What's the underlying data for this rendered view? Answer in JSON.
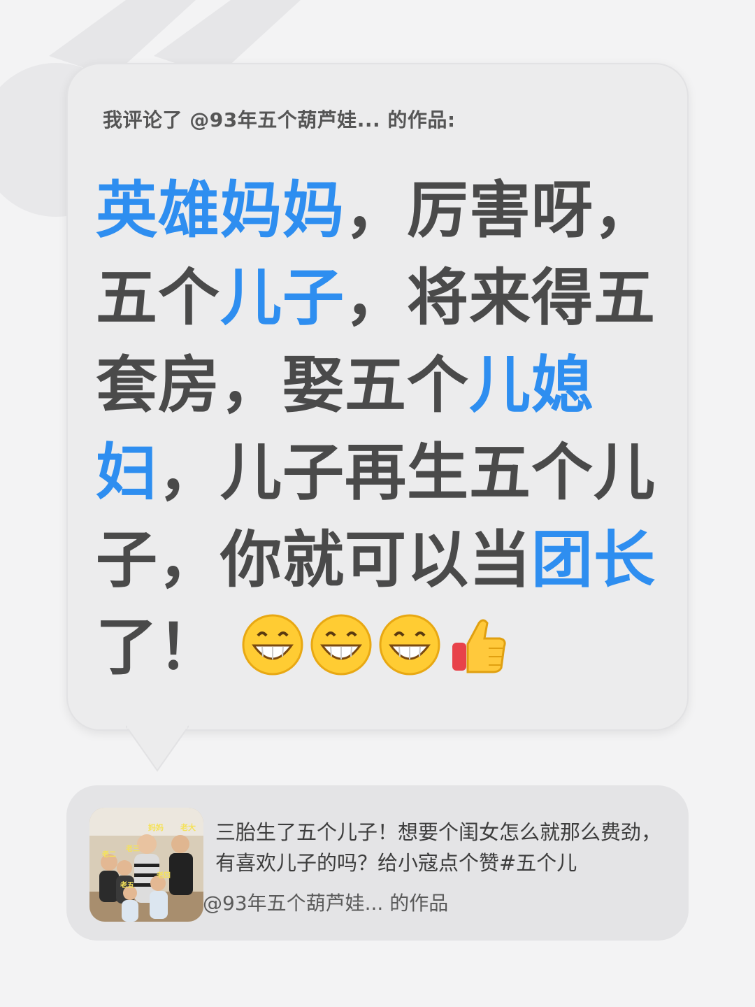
{
  "comment_header": "我评论了 @93年五个葫芦娃... 的作品:",
  "comment_segments": [
    {
      "text": "英雄妈妈",
      "highlight": true
    },
    {
      "text": "，厉害呀，五个",
      "highlight": false
    },
    {
      "text": "儿子",
      "highlight": true
    },
    {
      "text": "，将来得五套房，娶五个",
      "highlight": false
    },
    {
      "text": "儿媳妇",
      "highlight": true
    },
    {
      "text": "，儿子再生五个儿子，你就可以当",
      "highlight": false
    },
    {
      "text": "团长",
      "highlight": true
    },
    {
      "text": "了！",
      "highlight": false
    }
  ],
  "emojis": [
    "grin-emoji",
    "grin-emoji",
    "grin-emoji",
    "thumbs-up-emoji"
  ],
  "colors": {
    "highlight": "#2e8ef0",
    "text": "#4a4a4a",
    "background": "#f3f3f4"
  },
  "video_card": {
    "title": "三胎生了五个儿子！想要个闺女怎么就那么费劲，有喜欢儿子的吗？给小寇点个赞#五个儿",
    "author": "@93年五个葫芦娃... 的作品",
    "thumbnail_labels": [
      "妈妈",
      "老大",
      "老二",
      "老三",
      "老四",
      "老五"
    ]
  }
}
